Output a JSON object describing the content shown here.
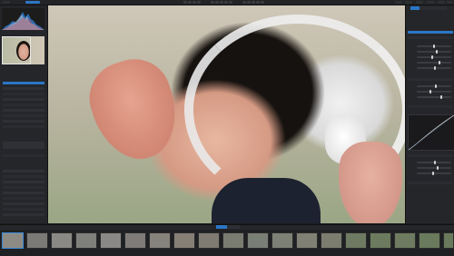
{
  "window": {
    "title": ""
  },
  "left_panel": {
    "histogram": {
      "label": ""
    },
    "navigator": {
      "label": ""
    },
    "file_list": [
      "",
      "",
      "",
      "",
      "",
      "",
      "",
      "",
      "",
      "",
      "",
      ""
    ]
  },
  "right_panel": {
    "tabs": [
      "",
      "",
      "",
      ""
    ],
    "sections": [
      "",
      "",
      "",
      "",
      ""
    ]
  },
  "filmstrip": {
    "tab_labels": [
      "",
      ""
    ],
    "items": [
      "",
      "",
      "",
      "",
      "",
      "",
      "",
      "",
      "",
      "",
      "",
      "",
      "",
      "",
      "",
      "",
      ""
    ]
  },
  "colors": {
    "accent": "#2b76c6",
    "panel_bg": "#25262a",
    "toolbar_bg": "#232427"
  }
}
